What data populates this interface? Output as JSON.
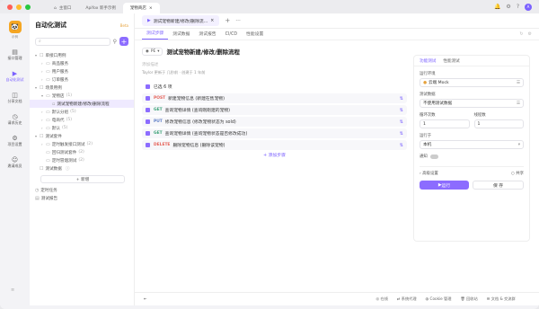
{
  "titlebar": {
    "tabs": [
      {
        "label": "主窗口"
      },
      {
        "label": "Apifox 新手示例"
      },
      {
        "label": "宠物商店"
      }
    ],
    "avatar": "A"
  },
  "rail": {
    "logo_text": "示例",
    "items": [
      {
        "label": "接口管理",
        "icon": "api-icon"
      },
      {
        "label": "自动化测试",
        "icon": "test-icon"
      },
      {
        "label": "分享文档",
        "icon": "share-icon"
      },
      {
        "label": "请求历史",
        "icon": "history-icon"
      },
      {
        "label": "项目设置",
        "icon": "settings-icon"
      },
      {
        "label": "邀请成员",
        "icon": "invite-icon"
      }
    ]
  },
  "sidebar": {
    "title": "自动化测试",
    "badge": "Beta",
    "tree": [
      {
        "label": "单接口用例",
        "count": "",
        "indent": 0,
        "arrow": "▾",
        "folder": false,
        "icon": "☐"
      },
      {
        "label": "商品服务",
        "count": "",
        "indent": 1,
        "arrow": "›",
        "folder": true
      },
      {
        "label": "用户服务",
        "count": "",
        "indent": 1,
        "arrow": "›",
        "folder": true
      },
      {
        "label": "订单服务",
        "count": "",
        "indent": 1,
        "arrow": "›",
        "folder": true
      },
      {
        "label": "场景用例",
        "count": "",
        "indent": 0,
        "arrow": "▾",
        "folder": false,
        "icon": "☐"
      },
      {
        "label": "宠物店",
        "count": "(1)",
        "indent": 1,
        "arrow": "▾",
        "folder": true
      },
      {
        "label": "测试宠物新建/修改/删除流程",
        "count": "",
        "indent": 2,
        "arrow": "",
        "folder": false,
        "icon": "▫",
        "selected": true
      },
      {
        "label": "默认分组",
        "count": "(5)",
        "indent": 1,
        "arrow": "›",
        "folder": true
      },
      {
        "label": "电商代",
        "count": "(5)",
        "indent": 1,
        "arrow": "›",
        "folder": true
      },
      {
        "label": "默认",
        "count": "(5)",
        "indent": 1,
        "arrow": "›",
        "folder": true
      },
      {
        "label": "测试套件",
        "count": "",
        "indent": 0,
        "arrow": "▾",
        "folder": false,
        "icon": "☐"
      },
      {
        "label": "定时触发接口测试",
        "count": "(2)",
        "indent": 1,
        "arrow": "›",
        "folder": true
      },
      {
        "label": "回归测试套件",
        "count": "(2)",
        "indent": 1,
        "arrow": "",
        "folder": true
      },
      {
        "label": "定时冒烟测试",
        "count": "(2)",
        "indent": 1,
        "arrow": "",
        "folder": true
      },
      {
        "label": "测试数据",
        "count": "",
        "indent": 0,
        "arrow": "",
        "folder": false,
        "icon": "☐",
        "info": true
      }
    ],
    "new_button": "+ 新增",
    "bottom": [
      {
        "label": "定时任务"
      },
      {
        "label": "测试报告"
      }
    ]
  },
  "main": {
    "doc_tab": "测试宠物新建/修改/删除流...",
    "sub_tabs": [
      "测试步骤",
      "测试数据",
      "测试报告",
      "CI/CD",
      "性能设置"
    ],
    "env": "PE",
    "case_title": "测试宠物新建/修改/删除流程",
    "desc_placeholder": "添加描述",
    "meta": "Taylor 更新于 几秒前 · 创建于 1 年前",
    "selected_count": "已选 6 项",
    "steps": [
      {
        "method": "POST",
        "color": "#e6635a",
        "text": "新建宠物信息 (新建在售宠物)"
      },
      {
        "method": "GET",
        "color": "#3fa37a",
        "text": "查询宠物详情 (查询刚刚建的宠物)"
      },
      {
        "method": "PUT",
        "color": "#5f7ec7",
        "text": "修改宠物信息 (修改宠物状态为 sold)"
      },
      {
        "method": "GET",
        "color": "#3fa37a",
        "text": "查询宠物详情 (查询宠物状态是否修改成功)"
      },
      {
        "method": "DELETE",
        "color": "#e6635a",
        "text": "删除宠物信息 (删除该宠物)"
      }
    ],
    "add_step": "+ 添加步骤"
  },
  "panel": {
    "tabs": [
      "功能测试",
      "性能测试"
    ],
    "env_label": "运行环境",
    "env_value": "云端 Mock",
    "data_label": "测试数据",
    "data_value": "不使用测试数据",
    "loop_label": "循环次数",
    "loop_value": "1",
    "thread_label": "线程数",
    "thread_value": "1",
    "runner_label": "运行于",
    "runner_value": "本机",
    "notify_label": "通知",
    "advanced": "高级设置",
    "share": "共享",
    "run": "运行",
    "save": "保 存"
  },
  "statusbar": {
    "items": [
      "在线",
      "系统代理",
      "Cookie 管理",
      "回收站",
      "文档 & 交流群"
    ]
  }
}
